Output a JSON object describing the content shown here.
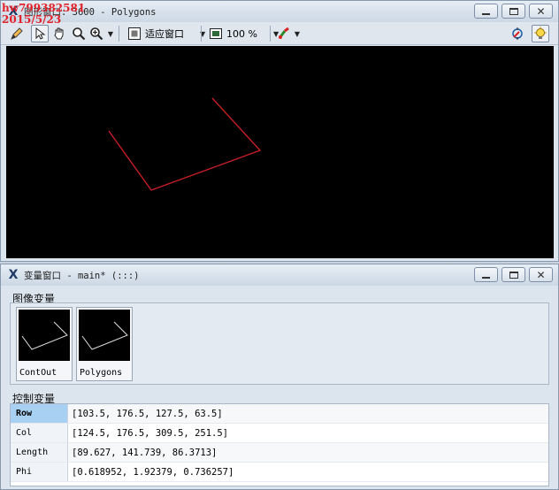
{
  "watermark": {
    "line1": "hw799382581",
    "line2": "2015/5/23"
  },
  "graphics_window": {
    "title": "图形窗口: 3600 - Polygons",
    "toolbar": {
      "fit_label": "适应窗口",
      "zoom_label": "100 %"
    }
  },
  "variable_window": {
    "title": "变量窗口 - main* (:::)",
    "image_section_label": "图像变量",
    "control_section_label": "控制变量",
    "image_vars": [
      {
        "name": "ContOut"
      },
      {
        "name": "Polygons"
      }
    ],
    "control_vars": [
      {
        "name": "Row",
        "value": "[103.5, 176.5, 127.5, 63.5]"
      },
      {
        "name": "Col",
        "value": "[124.5, 176.5, 309.5, 251.5]"
      },
      {
        "name": "Length",
        "value": "[89.627, 141.739, 86.3713]"
      },
      {
        "name": "Phi",
        "value": "[0.618952, 1.92379, 0.736257]"
      }
    ]
  },
  "colors": {
    "polygon_stroke": "#d11f26",
    "canvas_bg": "#000000",
    "selected_row": "#a8d0f2"
  },
  "icons": [
    "halcon-icon",
    "pencil-icon",
    "pointer-icon",
    "hand-icon",
    "magnifier-icon",
    "zoom-in-icon",
    "fit-window-icon",
    "zoom-percent-icon",
    "color-brush-icon",
    "crosshair-icon",
    "bulb-icon"
  ]
}
